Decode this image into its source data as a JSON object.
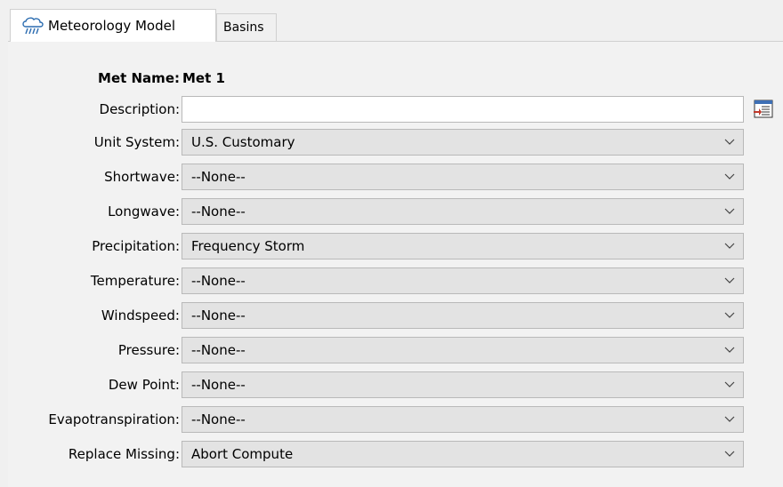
{
  "tabs": [
    {
      "label": "Meteorology Model",
      "icon": "meteorology-icon",
      "active": true
    },
    {
      "label": "Basins",
      "active": false
    }
  ],
  "met_name": {
    "label": "Met Name:",
    "value": "Met 1"
  },
  "description": {
    "label": "Description:",
    "value": "",
    "button_icon": "description-editor-icon"
  },
  "fields": [
    {
      "key": "unit-system",
      "label": "Unit System:",
      "value": "U.S. Customary"
    },
    {
      "key": "shortwave",
      "label": "Shortwave:",
      "value": "--None--"
    },
    {
      "key": "longwave",
      "label": "Longwave:",
      "value": "--None--"
    },
    {
      "key": "precipitation",
      "label": "Precipitation:",
      "value": "Frequency Storm"
    },
    {
      "key": "temperature",
      "label": "Temperature:",
      "value": "--None--"
    },
    {
      "key": "windspeed",
      "label": "Windspeed:",
      "value": "--None--"
    },
    {
      "key": "pressure",
      "label": "Pressure:",
      "value": "--None--"
    },
    {
      "key": "dew-point",
      "label": "Dew Point:",
      "value": "--None--"
    },
    {
      "key": "evapotranspiration",
      "label": "Evapotranspiration:",
      "value": "--None--"
    },
    {
      "key": "replace-missing",
      "label": "Replace Missing:",
      "value": "Abort Compute"
    }
  ]
}
